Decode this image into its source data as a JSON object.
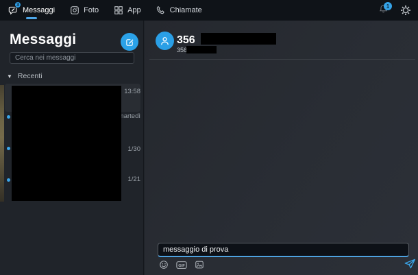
{
  "accent_color": "#35a3e8",
  "top_bar": {
    "tabs": [
      {
        "label": "Messaggi",
        "badge": "3",
        "active": true
      },
      {
        "label": "Foto",
        "active": false
      },
      {
        "label": "App",
        "active": false
      },
      {
        "label": "Chiamate",
        "active": false
      }
    ],
    "notifications_badge": "1"
  },
  "sidebar": {
    "title": "Messaggi",
    "search_placeholder": "Cerca nei messaggi",
    "section_label": "Recenti",
    "conversations": [
      {
        "timestamp": "13:58",
        "unread": false,
        "selected": true
      },
      {
        "timestamp": "martedì",
        "unread": true,
        "selected": false
      },
      {
        "timestamp": "1/30",
        "unread": true,
        "selected": false
      },
      {
        "timestamp": "1/21",
        "unread": true,
        "selected": false
      }
    ]
  },
  "chat": {
    "contact_name_visible": "356",
    "contact_number_visible": "356",
    "composer": {
      "value": "messaggio di prova",
      "gif_label": "GIF"
    }
  }
}
